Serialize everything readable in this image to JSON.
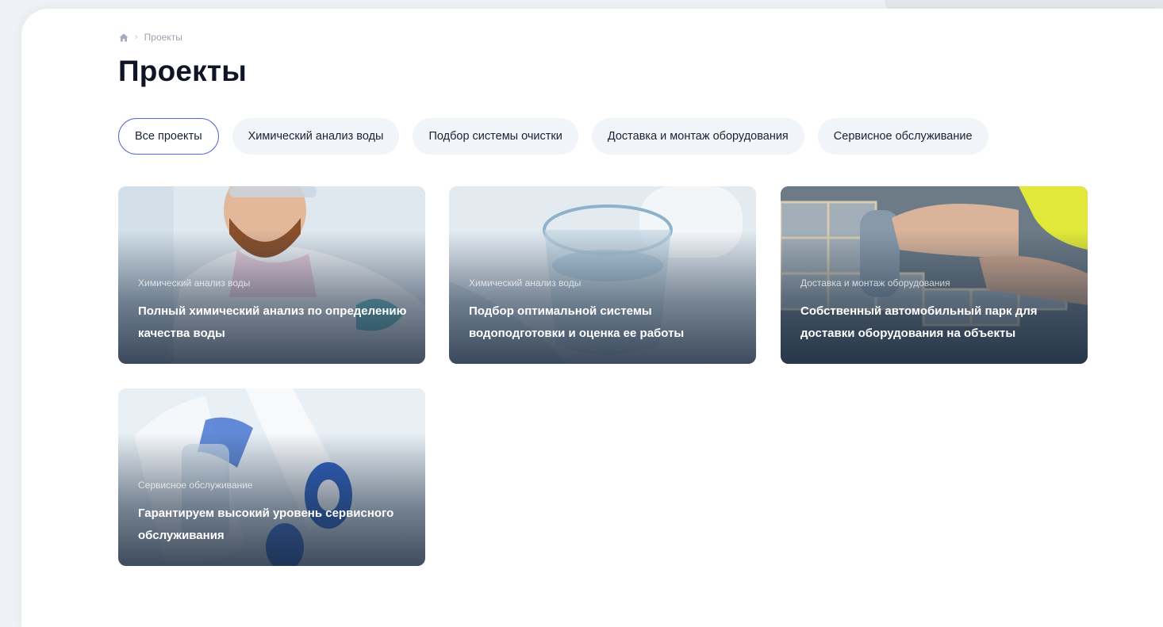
{
  "breadcrumb": {
    "home_icon": "home-icon",
    "separator": "›",
    "current": "Проекты"
  },
  "page_title": "Проекты",
  "filters": [
    {
      "label": "Все проекты",
      "active": true
    },
    {
      "label": "Химический анализ воды",
      "active": false
    },
    {
      "label": "Подбор системы очистки",
      "active": false
    },
    {
      "label": "Доставка и монтаж оборудования",
      "active": false
    },
    {
      "label": "Сервисное обслуживание",
      "active": false
    }
  ],
  "cards": [
    {
      "category": "Химический анализ воды",
      "title": "Полный химический анализ по определению качества воды"
    },
    {
      "category": "Химический анализ воды",
      "title": "Подбор оптимальной системы водоподготовки и оценка ее работы"
    },
    {
      "category": "Доставка и монтаж оборудования",
      "title": "Собственный автомобильный парк для доставки оборудования на объекты"
    },
    {
      "category": "Сервисное обслуживание",
      "title": "Гарантируем высокий уровень сервисного обслуживания"
    }
  ],
  "colors": {
    "active_chip_border": "#5566d8",
    "chip_bg": "#f1f4f8",
    "title": "#0f1524"
  }
}
